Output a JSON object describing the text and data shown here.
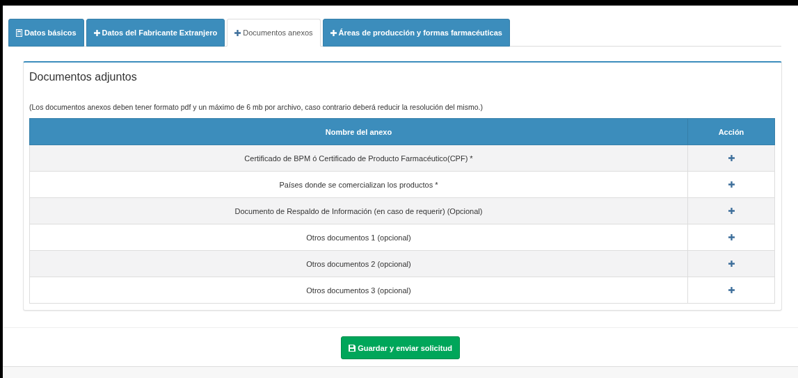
{
  "tabs": [
    {
      "label": "Datos básicos",
      "kind": "document",
      "selected": false
    },
    {
      "label": "Datos del Fabricante Extranjero",
      "kind": "plus",
      "selected": false
    },
    {
      "label": "Documentos anexos",
      "kind": "plus",
      "selected": true
    },
    {
      "label": "Áreas de producción y formas farmacéuticas",
      "kind": "plus",
      "selected": false
    }
  ],
  "panel": {
    "title": "Documentos adjuntos",
    "note": "(Los documentos anexos deben tener formato pdf y un máximo de 6 mb por archivo, caso contrario deberá reducir la resolución del mismo.)",
    "table": {
      "columns": [
        "Nombre del anexo",
        "Acción"
      ],
      "rows": [
        {
          "name": "Certificado de BPM ó Certificado de Producto Farmacéutico(CPF) *"
        },
        {
          "name": "Países donde se comercializan los productos *"
        },
        {
          "name": "Documento de Respaldo de Información (en caso de requerir) (Opcional)"
        },
        {
          "name": "Otros documentos 1 (opcional)"
        },
        {
          "name": "Otros documentos 2 (opcional)"
        },
        {
          "name": "Otros documentos 3 (opcional)"
        }
      ]
    }
  },
  "submit_button": {
    "label": "Guardar y enviar solicitud"
  }
}
